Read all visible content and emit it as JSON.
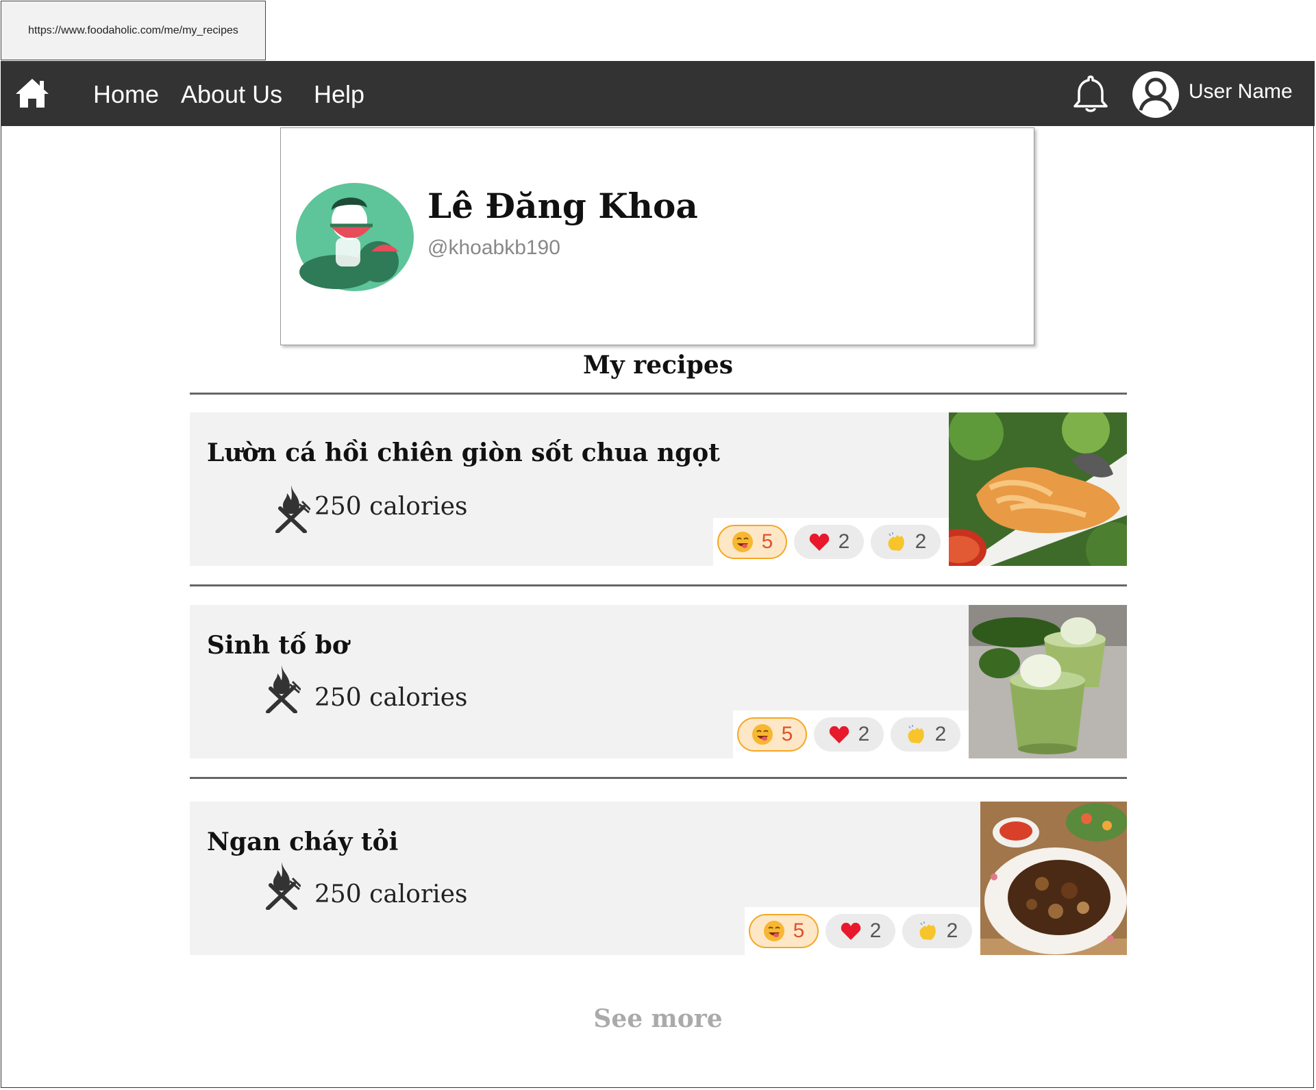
{
  "browser": {
    "url": "https://www.foodaholic.com/me/my_recipes"
  },
  "nav": {
    "home_icon": "home-icon",
    "links": [
      "Home",
      "About Us",
      "Help"
    ],
    "bell_icon": "bell-icon",
    "avatar_icon": "user-circle-icon",
    "username": "User Name"
  },
  "profile": {
    "name": "Lê Đăng Khoa",
    "handle": "@khoabkb190"
  },
  "section_title": "My recipes",
  "recipes": [
    {
      "title": "Lườn cá hồi chiên giòn sốt chua ngọt",
      "calories": "250 calories",
      "reactions": {
        "yum": "5",
        "love": "2",
        "clap": "2"
      }
    },
    {
      "title": "Sinh tố bơ",
      "calories": "250 calories",
      "reactions": {
        "yum": "5",
        "love": "2",
        "clap": "2"
      }
    },
    {
      "title": "Ngan cháy tỏi",
      "calories": "250 calories",
      "reactions": {
        "yum": "5",
        "love": "2",
        "clap": "2"
      }
    }
  ],
  "see_more": "See more",
  "colors": {
    "navbar": "#333333",
    "card_bg": "#f2f2f2",
    "avatar_green": "#5ec49a",
    "active_reaction": "#f5a623"
  }
}
